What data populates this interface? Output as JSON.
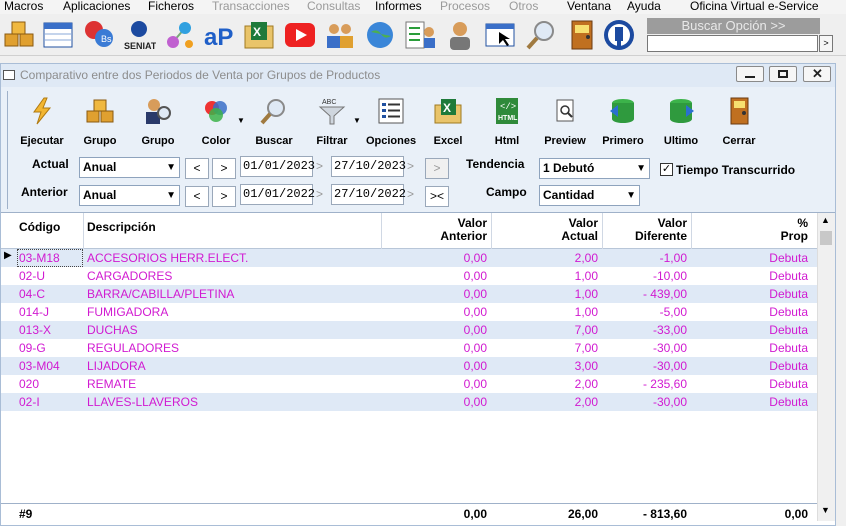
{
  "menu": [
    "Macros",
    "Aplicaciones",
    "Ficheros",
    "Transacciones",
    "Consultas",
    "Informes",
    "Procesos",
    "Otros",
    "Ventana",
    "Ayuda",
    "Oficina Virtual e-Service"
  ],
  "menu_disabled": [
    false,
    false,
    false,
    true,
    true,
    false,
    true,
    true,
    false,
    false,
    false
  ],
  "search": {
    "title": "Buscar Opción >>",
    "button": ">"
  },
  "window": {
    "title": "Comparativo entre dos Periodos de Venta por Grupos de Productos"
  },
  "toolbar": [
    "Ejecutar",
    "Grupo",
    "Grupo",
    "Color",
    "Buscar",
    "Filtrar",
    "Opciones",
    "Excel",
    "Html",
    "Preview",
    "Primero",
    "Ultimo",
    "Cerrar"
  ],
  "filters": {
    "actual_label": "Actual",
    "anterior_label": "Anterior",
    "actual_period": "Anual",
    "anterior_period": "Anual",
    "prev_btn": "<",
    "next_btn": ">",
    "swap_btn": "><",
    "extra_btn": ">",
    "actual_from": "01/01/2023",
    "actual_to": "27/10/2023",
    "anterior_from": "01/01/2022",
    "anterior_to": "27/10/2022",
    "tendencia_label": "Tendencia",
    "tendencia_value": "1 Debutó",
    "tiempo_label": "Tiempo Transcurrido",
    "tiempo_checked": "✓",
    "campo_label": "Campo",
    "campo_value": "Cantidad"
  },
  "grid": {
    "headers": {
      "codigo": "Código",
      "descripcion": "Descripción",
      "valor_anterior_1": "Valor",
      "valor_anterior_2": "Anterior",
      "valor_actual_1": "Valor",
      "valor_actual_2": "Actual",
      "valor_diferente_1": "Valor",
      "valor_diferente_2": "Diferente",
      "prop_1": "%",
      "prop_2": "Prop"
    },
    "rows": [
      {
        "codigo": "03-M18",
        "descripcion": "ACCESORIOS HERR.ELECT.",
        "anterior": "0,00",
        "actual": "2,00",
        "diferente": "-1,00",
        "prop": "Debuta"
      },
      {
        "codigo": "02-U",
        "descripcion": "CARGADORES",
        "anterior": "0,00",
        "actual": "1,00",
        "diferente": "-10,00",
        "prop": "Debuta"
      },
      {
        "codigo": "04-C",
        "descripcion": "BARRA/CABILLA/PLETINA",
        "anterior": "0,00",
        "actual": "1,00",
        "diferente": "- 439,00",
        "prop": "Debuta"
      },
      {
        "codigo": "014-J",
        "descripcion": "FUMIGADORA",
        "anterior": "0,00",
        "actual": "1,00",
        "diferente": "-5,00",
        "prop": "Debuta"
      },
      {
        "codigo": "013-X",
        "descripcion": "DUCHAS",
        "anterior": "0,00",
        "actual": "7,00",
        "diferente": "-33,00",
        "prop": "Debuta"
      },
      {
        "codigo": "09-G",
        "descripcion": "REGULADORES",
        "anterior": "0,00",
        "actual": "7,00",
        "diferente": "-30,00",
        "prop": "Debuta"
      },
      {
        "codigo": "03-M04",
        "descripcion": "LIJADORA",
        "anterior": "0,00",
        "actual": "3,00",
        "diferente": "-30,00",
        "prop": "Debuta"
      },
      {
        "codigo": "020",
        "descripcion": "REMATE",
        "anterior": "0,00",
        "actual": "2,00",
        "diferente": "- 235,60",
        "prop": "Debuta"
      },
      {
        "codigo": "02-I",
        "descripcion": "LLAVES-LLAVEROS",
        "anterior": "0,00",
        "actual": "2,00",
        "diferente": "-30,00",
        "prop": "Debuta"
      }
    ],
    "footer": {
      "count": "#9",
      "anterior": "0,00",
      "actual": "26,00",
      "diferente": "- 813,60",
      "prop": "0,00"
    }
  },
  "colors": {
    "row_text": "#d11ad1",
    "alt_row": "#dfe9f6",
    "toolbar_bg": "#e9f0f8"
  }
}
